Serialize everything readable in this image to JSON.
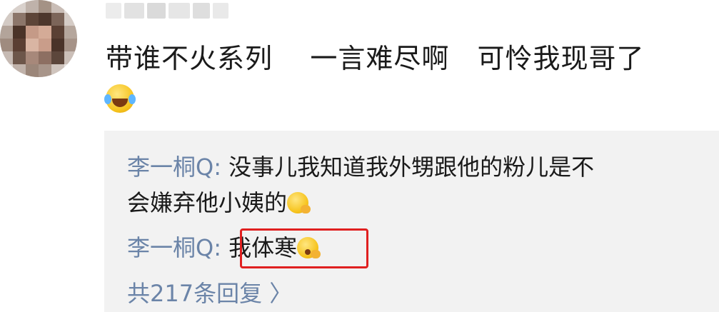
{
  "comment": {
    "text": "带谁不火系列    一言难尽啊   可怜我现哥了",
    "emoji": "laughing-crying-emoji"
  },
  "replies": [
    {
      "user": "李一桐Q:",
      "line1": " 没事儿我知道我外甥跟他的粉儿是不",
      "line2": "会嫌弃他小姨的",
      "emoji": "thinking-emoji"
    },
    {
      "user": "李一桐Q:",
      "text": " 我体寒",
      "emoji": "shush-emoji"
    }
  ],
  "more_replies_label": "共217条回复 〉",
  "colors": {
    "reply_user": "#6b84a8",
    "reply_bg": "#f2f2f2",
    "highlight": "#e02020"
  }
}
